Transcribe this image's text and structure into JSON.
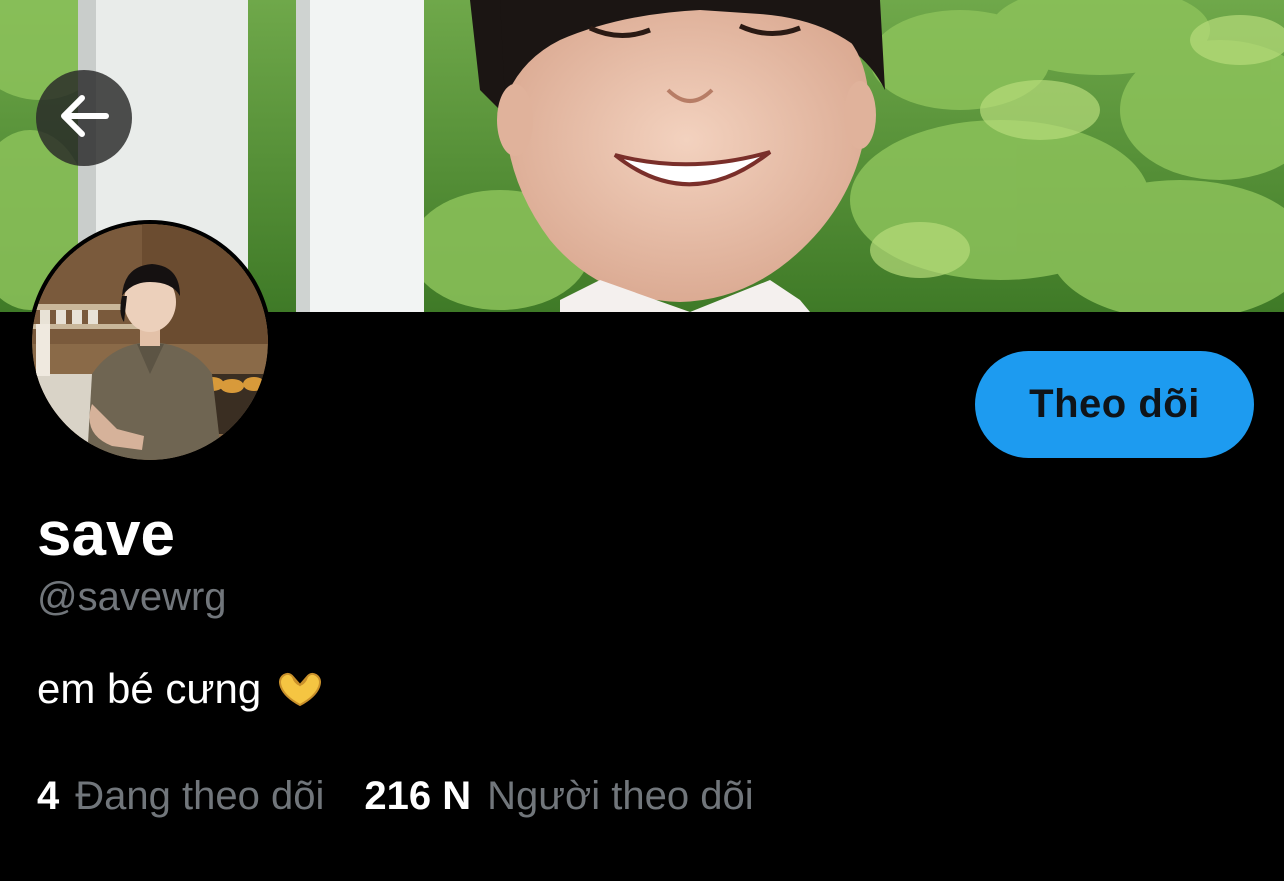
{
  "profile": {
    "display_name": "save",
    "handle": "@savewrg",
    "bio": "em bé cưng",
    "bio_emoji": "heart-hands-emoji"
  },
  "actions": {
    "follow_label": "Theo dõi"
  },
  "stats": {
    "following_count": "4",
    "following_label": "Đang theo dõi",
    "followers_count": "216 N",
    "followers_label": "Người theo dõi"
  },
  "icons": {
    "back": "arrow-left-icon"
  },
  "colors": {
    "background": "#000000",
    "accent": "#1d9bf0",
    "primary_text": "#ffffff",
    "secondary_text": "#71767b"
  }
}
